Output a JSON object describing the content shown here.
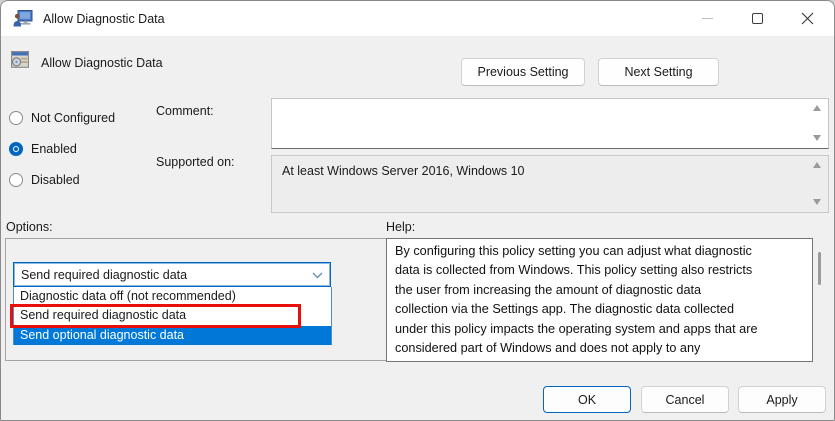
{
  "window": {
    "title": "Allow Diagnostic Data"
  },
  "header": {
    "title": "Allow Diagnostic Data",
    "previous_button": "Previous Setting",
    "next_button": "Next Setting"
  },
  "config": {
    "radio_not_configured": "Not Configured",
    "radio_enabled": "Enabled",
    "radio_disabled": "Disabled",
    "selected_radio": "Enabled",
    "comment_label": "Comment:",
    "comment_value": "",
    "supported_label": "Supported on:",
    "supported_value": "At least Windows Server 2016, Windows 10"
  },
  "options": {
    "label": "Options:",
    "dropdown": {
      "value": "Send required diagnostic data",
      "items": [
        "Diagnostic data off (not recommended)",
        "Send required diagnostic data",
        "Send optional diagnostic data"
      ],
      "highlighted_item": "Send optional diagnostic data",
      "red_annotated_item": "Send required diagnostic data"
    }
  },
  "help": {
    "label": "Help:",
    "text": "By configuring this policy setting you can adjust what diagnostic data is collected from Windows. This policy setting also restricts the user from increasing the amount of diagnostic data collection via the Settings app. The diagnostic data collected under this policy impacts the operating system and apps that are considered part of Windows and does not apply to any",
    "lines": [
      "By configuring this policy setting you can adjust what diagnostic",
      "data is collected from Windows. This policy setting also restricts",
      "the user from increasing the amount of diagnostic data",
      "collection via the Settings app. The diagnostic data collected",
      "under this policy impacts the operating system and apps that are",
      "considered part of Windows and does not apply to any"
    ]
  },
  "footer": {
    "ok": "OK",
    "cancel": "Cancel",
    "apply": "Apply"
  },
  "colors": {
    "accent_blue": "#0067c0",
    "selection_blue": "#0078d7",
    "annotation_red": "#e90f0a",
    "window_bg": "#f0f0f0"
  }
}
